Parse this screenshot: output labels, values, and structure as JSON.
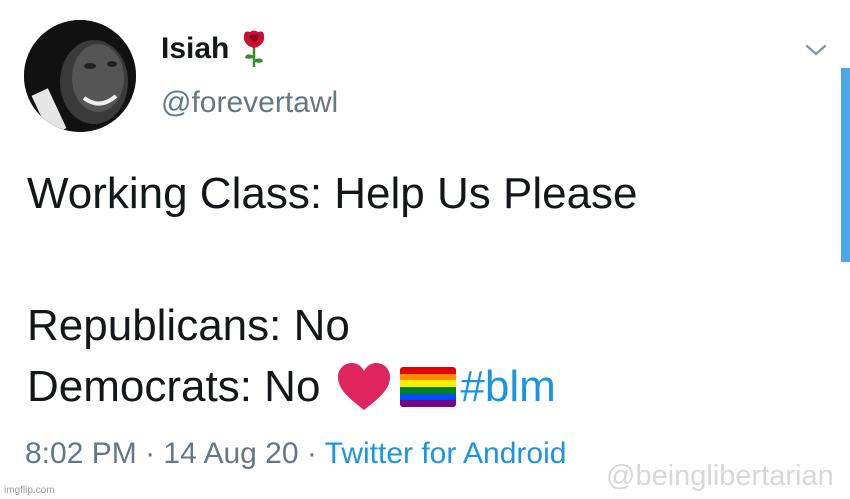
{
  "user": {
    "display_name": "Isiah",
    "handle": "@forevertawl",
    "avatar": "profile-photo",
    "name_emoji": "rose-icon"
  },
  "tweet": {
    "line1": "Working Class: Help Us Please",
    "line2": "Republicans: No",
    "line3_text": "Democrats: No",
    "line3_emojis": [
      "heart-icon",
      "rainbow-flag-icon"
    ],
    "hashtag": "#blm"
  },
  "meta": {
    "time": "8:02 PM",
    "separator": " · ",
    "date": "14 Aug 20",
    "source": "Twitter for Android"
  },
  "watermark": "@beinglibertarian",
  "imgflip_tag": "imgflip.com",
  "colors": {
    "text": "#14171a",
    "secondary": "#657786",
    "link": "#1b95e0",
    "heart": "#e0245e",
    "scrollbar": "#4aa8e8"
  },
  "flag_colors": [
    "#e40303",
    "#ff8c00",
    "#ffed00",
    "#008026",
    "#004dff",
    "#750787"
  ]
}
